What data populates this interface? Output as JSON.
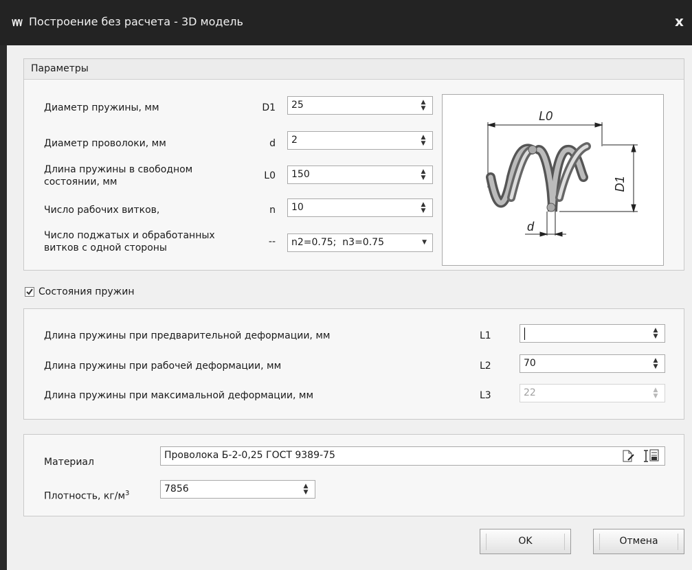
{
  "window": {
    "title": "Построение без расчета - 3D модель",
    "close_glyph": "x"
  },
  "params": {
    "title": "Параметры",
    "rows": [
      {
        "label": "Диаметр пружины, мм",
        "symbol": "D1",
        "value": "25"
      },
      {
        "label": "Диаметр проволоки, мм",
        "symbol": "d",
        "value": "2"
      },
      {
        "label": "Длина пружины в свободном\nсостоянии, мм",
        "symbol": "L0",
        "value": "150"
      },
      {
        "label": "Число рабочих витков,",
        "symbol": "n",
        "value": "10"
      },
      {
        "label": "Число поджатых и обработанных\nвитков с одной стороны",
        "symbol": "--",
        "value": "n2=0.75;  n3=0.75"
      }
    ],
    "diagram": {
      "l0": "L0",
      "d1": "D1",
      "d": "d"
    }
  },
  "states": {
    "checkbox_label": "Состояния пружин",
    "checked": true,
    "rows": [
      {
        "label": "Длина пружины при предварительной деформации, мм",
        "symbol": "L1",
        "value": ""
      },
      {
        "label": "Длина пружины при рабочей деформации, мм",
        "symbol": "L2",
        "value": "70"
      },
      {
        "label": "Длина пружины при максимальной деформации, мм",
        "symbol": "L3",
        "value": "22"
      }
    ]
  },
  "material": {
    "material_label": "Материал",
    "material_value": "Проволока Б-2-0,25 ГОСТ 9389-75",
    "density_label": "Плотность, кг/м",
    "density_sup": "3",
    "density_value": "7856"
  },
  "buttons": {
    "ok": "OK",
    "cancel": "Отмена"
  },
  "icons": [
    "app-icon",
    "close-icon",
    "spin-arrows-icon",
    "dropdown-arrow-icon",
    "checkbox-check-icon",
    "edit-document-icon",
    "select-material-icon"
  ]
}
